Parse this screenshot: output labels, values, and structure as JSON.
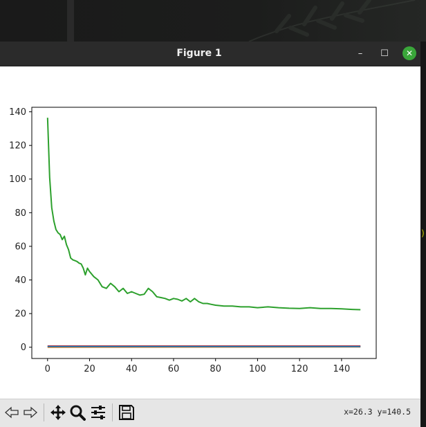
{
  "window": {
    "title": "Figure 1",
    "minimize_label": "–",
    "maximize_label": "☐",
    "close_label": "✕"
  },
  "colors": {
    "accent_close": "#3aa63a",
    "series_green": "#2ca02c",
    "series_red": "#d62728",
    "series_orange": "#ff7f0e",
    "series_blue": "#1f77b4"
  },
  "toolbar": {
    "icons": [
      "back-icon",
      "forward-icon",
      "pan-icon",
      "zoom-icon",
      "configure-subplots-icon",
      "save-icon"
    ],
    "coordinates": "x=26.3 y=140.5"
  },
  "side_mark": ")",
  "chart_data": {
    "type": "line",
    "title": "",
    "xlabel": "",
    "ylabel": "",
    "xlim": [
      -7.5,
      156.5
    ],
    "ylim": [
      -6.7,
      142.7
    ],
    "x_ticks": [
      0,
      20,
      40,
      60,
      80,
      100,
      120,
      140
    ],
    "y_ticks": [
      0,
      20,
      40,
      60,
      80,
      100,
      120,
      140
    ],
    "grid": false,
    "series": [
      {
        "color": "#2ca02c",
        "x": [
          0,
          1,
          2,
          3,
          4,
          5,
          6,
          7,
          8,
          9,
          10,
          11,
          12,
          13,
          14,
          15,
          16,
          17,
          18,
          19,
          20,
          22,
          24,
          26,
          28,
          30,
          32,
          34,
          36,
          38,
          40,
          42,
          44,
          46,
          48,
          50,
          52,
          54,
          56,
          58,
          60,
          62,
          64,
          66,
          68,
          70,
          72,
          74,
          76,
          78,
          80,
          84,
          88,
          92,
          96,
          100,
          105,
          110,
          115,
          120,
          125,
          130,
          135,
          140,
          145,
          149
        ],
        "values": [
          136.5,
          101,
          83,
          75,
          70,
          68,
          67,
          64,
          66,
          61,
          58,
          53,
          52,
          51.5,
          51,
          50,
          49.5,
          47,
          43,
          47,
          45,
          42,
          40,
          36,
          35,
          38,
          36,
          33,
          35,
          32,
          33,
          32,
          31,
          31.5,
          35,
          33,
          30,
          29.5,
          29,
          28,
          29,
          28.5,
          27.5,
          29,
          27,
          29,
          27,
          26,
          26,
          25.5,
          25,
          24.5,
          24.5,
          24,
          24,
          23.5,
          24,
          23.5,
          23.2,
          23,
          23.5,
          23,
          23,
          22.8,
          22.5,
          22.3
        ]
      },
      {
        "color": "#d62728",
        "x": [
          0,
          149
        ],
        "values": [
          0.7,
          0.7
        ]
      },
      {
        "color": "#ff7f0e",
        "x": [
          0,
          149
        ],
        "values": [
          0.0,
          0.2
        ]
      },
      {
        "color": "#1f77b4",
        "x": [
          0,
          149
        ],
        "values": [
          0.4,
          0.4
        ]
      }
    ]
  }
}
